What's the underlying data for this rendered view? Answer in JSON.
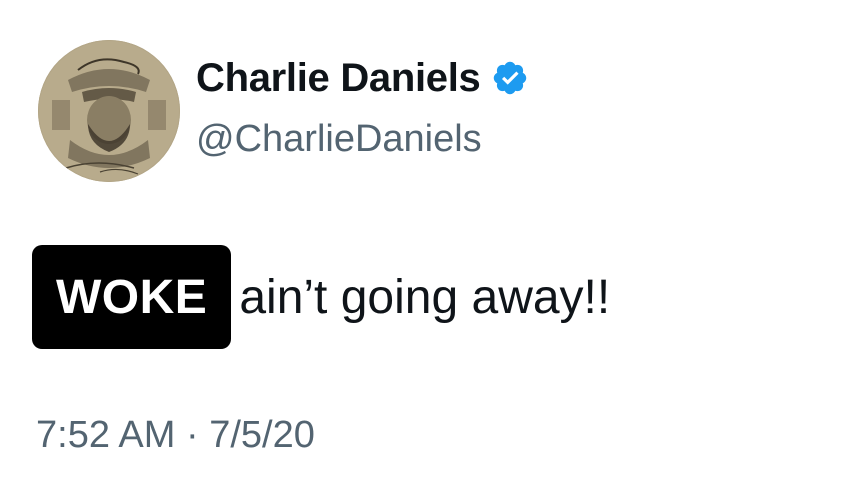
{
  "author": {
    "display_name": "Charlie Daniels",
    "handle": "@CharlieDaniels",
    "verified_icon": "verified-badge-icon",
    "verified_color": "#1d9bf0",
    "avatar": "avatar-logo-image"
  },
  "tweet": {
    "highlight": "WOKE",
    "text": "ain’t going away!!"
  },
  "meta": {
    "timestamp": "7:52 AM · 7/5/20"
  },
  "colors": {
    "text": "#0f1419",
    "secondary": "#536471",
    "highlight_bg": "#000000",
    "highlight_text": "#ffffff"
  }
}
